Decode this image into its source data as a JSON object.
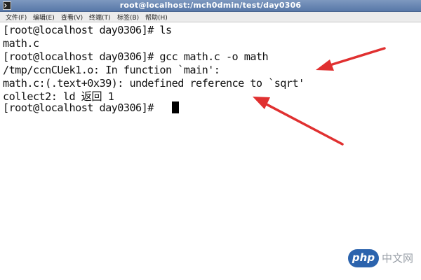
{
  "window": {
    "title": "root@localhost:/mch0dmin/test/day0306"
  },
  "menu": [
    {
      "label": "文件(F)"
    },
    {
      "label": "编辑(E)"
    },
    {
      "label": "查看(V)"
    },
    {
      "label": "终端(T)"
    },
    {
      "label": "标签(B)"
    },
    {
      "label": "帮助(H)"
    }
  ],
  "terminal": {
    "lines": [
      "[root@localhost day0306]# ls",
      "math.c",
      "[root@localhost day0306]# gcc math.c -o math",
      "/tmp/ccnCUek1.o: In function `main':",
      "math.c:(.text+0x39): undefined reference to `sqrt'",
      "collect2: ld 返回 1",
      "[root@localhost day0306]# "
    ]
  },
  "watermark": {
    "logo": "php",
    "text": "中文网"
  },
  "colors": {
    "annotation_arrow": "#e03030",
    "titlebar": "#6a88b5",
    "watermark_logo": "#2b63ad"
  }
}
